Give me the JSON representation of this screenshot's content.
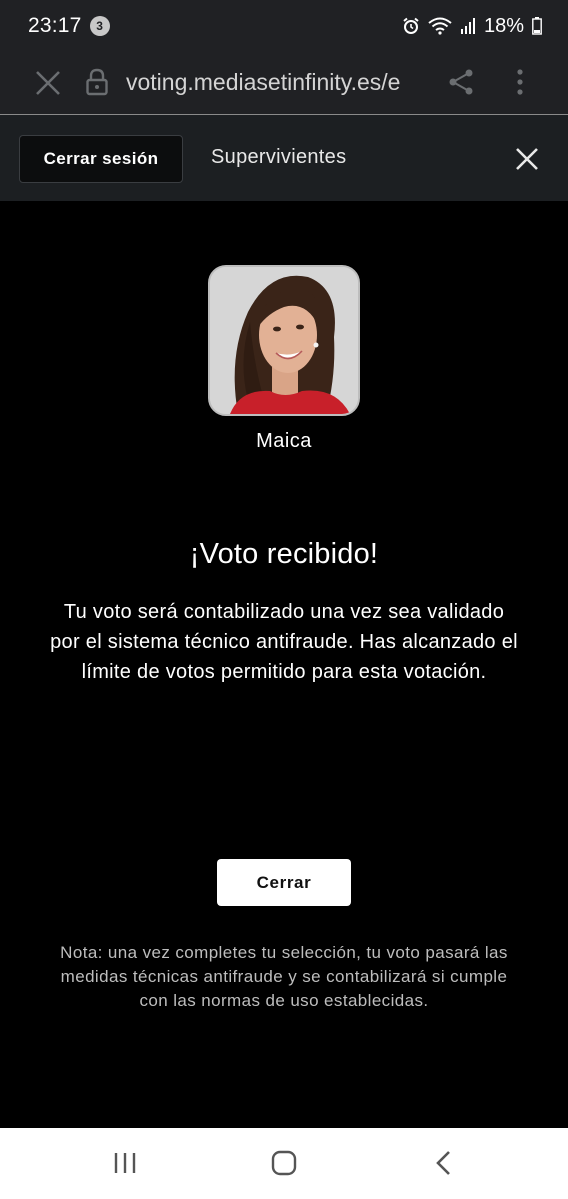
{
  "status_bar": {
    "time": "23:17",
    "notification_count": "3",
    "battery": "18%"
  },
  "browser": {
    "url": "voting.mediasetinfinity.es/e",
    "icons": [
      "close-icon",
      "lock-icon",
      "share-icon",
      "more-vert-icon"
    ]
  },
  "header": {
    "logout_label": "Cerrar sesión",
    "title": "Supervivientes",
    "close_icon": "close-icon"
  },
  "contestant": {
    "name": "Maica"
  },
  "result": {
    "title": "¡Voto recibido!",
    "message": "Tu voto será contabilizado una vez sea validado por el sistema técnico antifraude. Has alcanzado el límite de votos permitido para esta votación."
  },
  "close_button_label": "Cerrar",
  "note": "Nota: una vez completes tu selección, tu voto pasará las medidas técnicas antifraude y se contabilizará si cumple con las normas de uso establecidas.",
  "colors": {
    "background": "#000000",
    "header_bg": "#1c1f22",
    "browser_bg": "#202124",
    "primary_button": "#ffffff",
    "note_text": "#bdbdbd"
  },
  "nav_icons": [
    "recent-apps-icon",
    "home-icon",
    "back-icon"
  ]
}
